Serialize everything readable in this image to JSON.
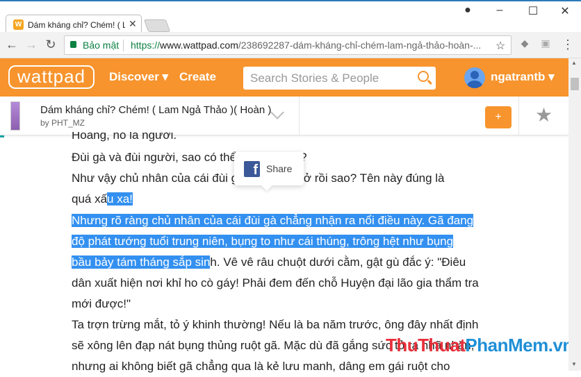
{
  "browser": {
    "tab_title": "Dám kháng chỉ? Chém! ( Lam Ngả Thảo )( Hoàn )",
    "tab_icon": "W",
    "secure_label": "Bảo mật",
    "url_scheme": "https://",
    "url_host": "www.wattpad.com",
    "url_path": "/238692287-dám-kháng-chỉ-chém-lam-ngả-thảo-hoàn-..."
  },
  "header": {
    "logo": "wattpad",
    "discover": "Discover ▾",
    "create": "Create",
    "search_placeholder": "Search Stories & People",
    "username": "ngatrantb ▾",
    "brand_color": "#f7942d"
  },
  "story": {
    "title": "Dám kháng chỉ? Chém! ( Lam Ngả Thảo )( Hoàn )",
    "author": "by PHT_MZ",
    "add_label": "+"
  },
  "share_popup": {
    "label": "Share"
  },
  "content": {
    "l0": "Hoàng, nó là người.",
    "l1a": "Đùi gà và đùi người, sao có thể c",
    "l1b": "ớ?",
    "l2a": "Như vậy chủ nhân của cái đùi gà",
    "l2b": "vỡ bở rồi sao? Tên này đúng là",
    "l3a": "quá xấ",
    "l3b": "u xa!",
    "l4": "Nhưng rõ ràng chủ nhân của cái đùi gà chẳng nhận ra nổi điều này. Gã đang",
    "l5": "độ phát tướng tuổi trung niên, bụng to như cái thúng, trông hệt như bụng",
    "l6a": "bầu bảy tám tháng sắp sin",
    "l6b": "h. Vê vê râu chuột dưới cằm, gật gù đắc ý: \"Điêu",
    "l7": "dân xuất hiện nơi khỉ ho cò gáy! Phải đem đến chỗ Huyện đại lão gia thẩm tra",
    "l8": "mới được!\"",
    "l9": "Ta trợn trừng mắt, tỏ ý khinh thường! Nếu là ba năm trước, ông đây nhất định",
    "l10": "sẽ xông lên đạp nát bụng thủng ruột gã. Mặc dù đã gắng sức tỏ ra nhã nhặn,",
    "l11": "nhưng ai không biết gã chẳng qua là kẻ lưu manh, dâng em gái ruột cho",
    "selection_color": "#3390f0"
  },
  "watermark": {
    "part1": "ThuThuat",
    "part2": "PhanMem.vn"
  }
}
